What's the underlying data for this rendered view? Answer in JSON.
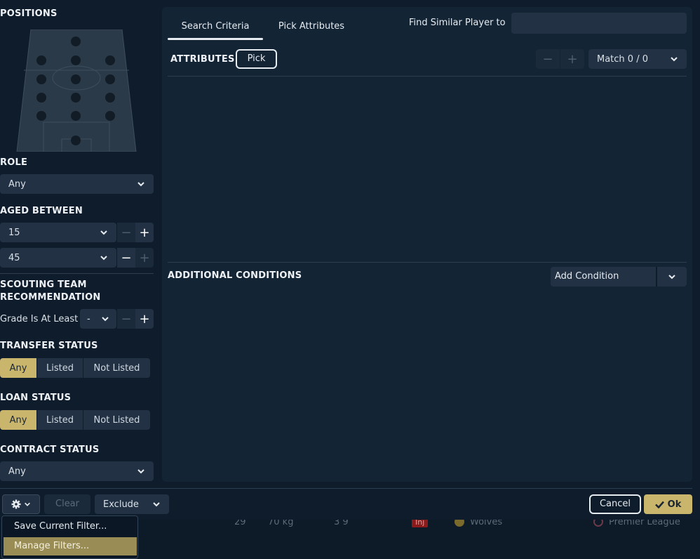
{
  "left": {
    "positions_title": "POSITIONS",
    "role": {
      "title": "ROLE",
      "value": "Any"
    },
    "aged": {
      "title": "AGED BETWEEN",
      "min": "15",
      "max": "45"
    },
    "scouting": {
      "title_line1": "SCOUTING TEAM",
      "title_line2": "RECOMMENDATION",
      "grade_label": "Grade Is At Least",
      "grade_value": "-"
    },
    "transfer": {
      "title": "TRANSFER STATUS",
      "options": [
        "Any",
        "Listed",
        "Not Listed"
      ],
      "selected": "Any"
    },
    "loan": {
      "title": "LOAN STATUS",
      "options": [
        "Any",
        "Listed",
        "Not Listed"
      ],
      "selected": "Any"
    },
    "contract": {
      "title": "CONTRACT STATUS",
      "value": "Any"
    }
  },
  "main": {
    "tabs": [
      "Search Criteria",
      "Pick Attributes"
    ],
    "find_similar_label": "Find Similar Player to",
    "find_similar_placeholder": "",
    "attributes_title": "ATTRIBUTES",
    "pick_label": "Pick",
    "match_label": "Match 0 / 0",
    "additional_title": "ADDITIONAL CONDITIONS",
    "add_condition_label": "Add Condition"
  },
  "footer": {
    "clear_label": "Clear",
    "exclude_label": "Exclude",
    "cancel_label": "Cancel",
    "ok_label": "Ok"
  },
  "menu": {
    "items": [
      "Save Current Filter...",
      "Manage Filters..."
    ],
    "highlighted": "Manage Filters..."
  },
  "background_row": {
    "age": "29",
    "weight": "70 kg",
    "value": "3 9",
    "badge": "Inj",
    "club": "Wolves",
    "league": "Premier League"
  },
  "colors": {
    "accent": "#c9b56b",
    "panel": "#132435",
    "control": "#223244",
    "badge_red": "#8b1a1a"
  }
}
